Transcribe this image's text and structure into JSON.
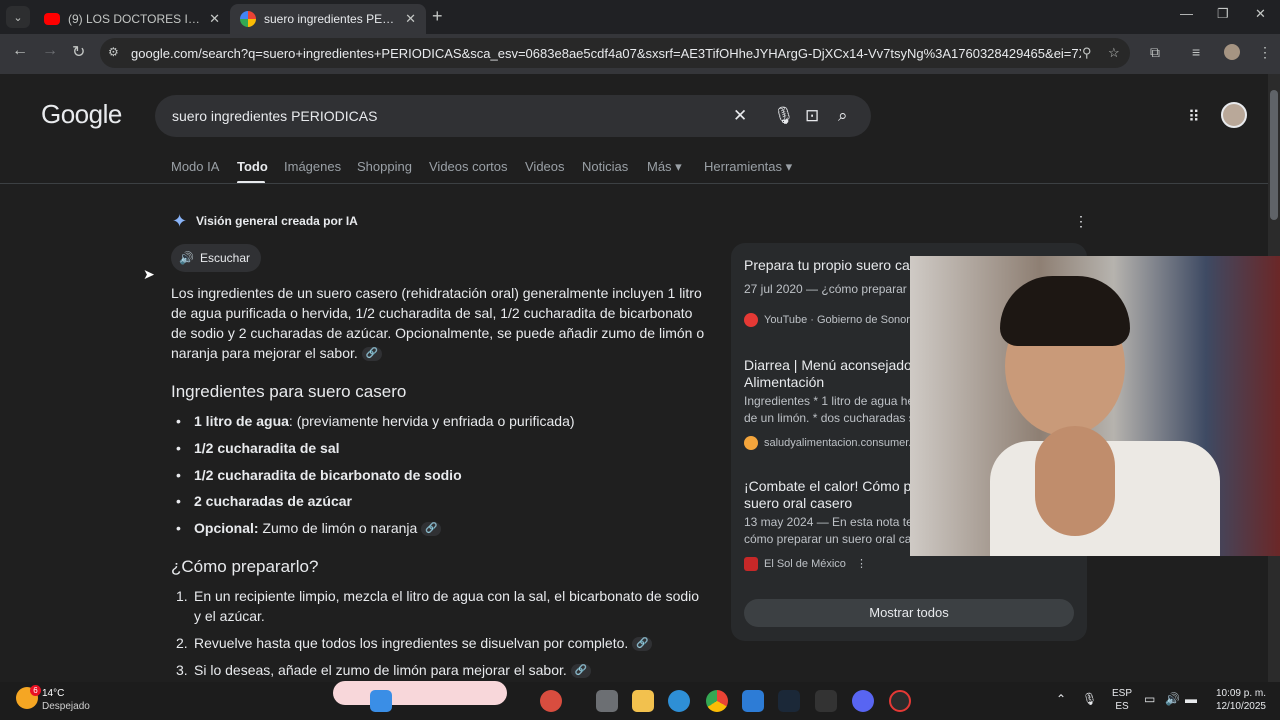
{
  "browser": {
    "tabs": [
      {
        "title": "(9) LOS DOCTORES INFLUENCERS",
        "active": false
      },
      {
        "title": "suero ingredientes PERIODICAS",
        "active": true
      }
    ],
    "url": "google.com/search?q=suero+ingredientes+PERIODICAS&sca_esv=0683e8ae5cdf4a07&sxsrf=AE3TifOHheJYHArgG-DjXCx14-Vv7tsyNg%3A1760328429465&ei=7Xrsal2SHJSlqtsP7val..."
  },
  "google": {
    "logo": "Google",
    "query": "suero ingredientes PERIODICAS",
    "nav_tabs": [
      "Modo IA",
      "Todo",
      "Imágenes",
      "Shopping",
      "Videos cortos",
      "Videos",
      "Noticias",
      "Más ▾",
      "Herramientas ▾"
    ]
  },
  "ai_overview": {
    "title": "Visión general creada por IA",
    "listen_label": "Escuchar",
    "intro": "Los ingredientes de un suero casero (rehidratación oral) generalmente incluyen 1 litro de agua purificada o hervida, 1/2 cucharadita de sal, 1/2 cucharadita de bicarbonato de sodio y 2 cucharadas de azúcar. Opcionalmente, se puede añadir zumo de limón o naranja para mejorar el sabor.",
    "ingredients_heading": "Ingredientes para suero casero",
    "ingredients": [
      {
        "bold": "1 litro de agua",
        "rest": ": (previamente hervida y enfriada o purificada)"
      },
      {
        "bold": "1/2 cucharadita de sal",
        "rest": ""
      },
      {
        "bold": "1/2 cucharadita de bicarbonato de sodio",
        "rest": ""
      },
      {
        "bold": "2 cucharadas de azúcar",
        "rest": ""
      },
      {
        "bold": "Opcional:",
        "rest": " Zumo de limón o naranja"
      }
    ],
    "howto_heading": "¿Cómo prepararlo?",
    "steps": [
      {
        "num": "1.",
        "text": "En un recipiente limpio, mezcla el litro de agua con la sal, el bicarbonato de sodio y el azúcar."
      },
      {
        "num": "2.",
        "text": "Revuelve hasta que todos los ingredientes se disuelvan por completo."
      },
      {
        "num": "3.",
        "text": "Si lo deseas, añade el zumo de limón para mejorar el sabor."
      }
    ]
  },
  "side_results": [
    {
      "title": "Prepara tu propio suero cas",
      "sub": "27 jul 2020 — ¿cómo preparar u",
      "source": "YouTube · Gobierno de Sonora",
      "icon_color": "#e53935"
    },
    {
      "title": "Diarrea | Menú aconsejado\nAlimentación",
      "sub": "Ingredientes * 1 litro de agua he\nde un limón. * dos cucharadas s",
      "source": "saludyalimentacion.consumer.es",
      "icon_color": "#f4a53c"
    },
    {
      "title": "¡Combate el calor! Cómo pr\nsuero oral casero",
      "sub": "13 may 2024 — En esta nota te\ncómo preparar un suero oral cas",
      "source": "El Sol de México",
      "icon_color": "#c62828"
    }
  ],
  "show_all_label": "Mostrar todos",
  "taskbar": {
    "weather_temp": "14°C",
    "weather_desc": "Despejado",
    "weather_badge": "6",
    "lang_line1": "ESP",
    "lang_line2": "ES",
    "time": "10:09 p. m.",
    "date": "12/10/2025"
  }
}
